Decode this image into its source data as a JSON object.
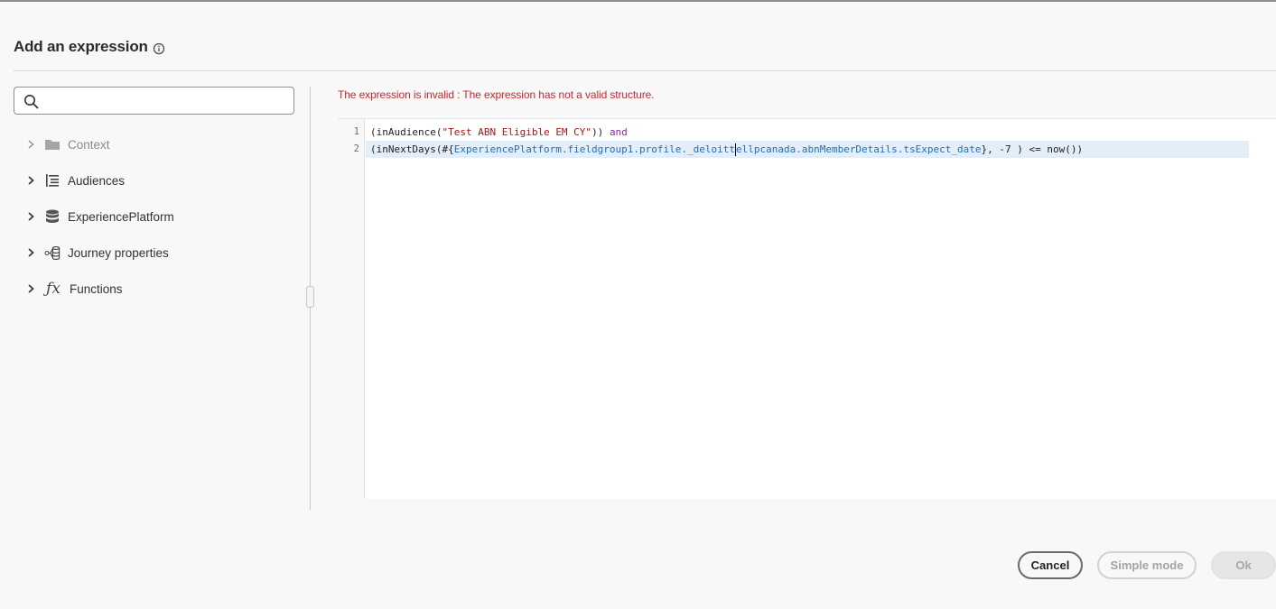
{
  "dialog": {
    "title": "Add an expression",
    "info_icon": "info-icon"
  },
  "search": {
    "placeholder": "",
    "value": ""
  },
  "tree": {
    "items": [
      {
        "label": "Context",
        "icon": "folder-icon",
        "disabled": true
      },
      {
        "label": "Audiences",
        "icon": "audience-list-icon",
        "disabled": false
      },
      {
        "label": "ExperiencePlatform",
        "icon": "database-icon",
        "disabled": false
      },
      {
        "label": "Journey properties",
        "icon": "journey-properties-icon",
        "disabled": false
      },
      {
        "label": "Functions",
        "icon": "function-fx-icon",
        "disabled": false
      }
    ]
  },
  "editor": {
    "error_message": "The expression is invalid : The expression has not a valid structure.",
    "line_numbers": [
      "1",
      "2"
    ],
    "line1": {
      "prefix": "(inAudience(",
      "string": "\"Test ABN Eligible EM CY\"",
      "suffix": ")) ",
      "keyword": "and"
    },
    "line2": {
      "prefix": "(inNextDays(#{",
      "field_before_caret": "ExperiencePlatform.fieldgroup1.profile._deloitt",
      "field_after_caret": "ellpcanada.abnMemberDetails.tsExpect_date",
      "suffix": "}, -7 ) <= now())"
    }
  },
  "footer": {
    "cancel_label": "Cancel",
    "simple_mode_label": "Simple mode",
    "ok_label": "Ok"
  },
  "colors": {
    "error": "#c9252d",
    "string": "#a31515",
    "keyword": "#7a2e98",
    "field": "#1f6fbd",
    "active_line": "#e4eef9"
  }
}
